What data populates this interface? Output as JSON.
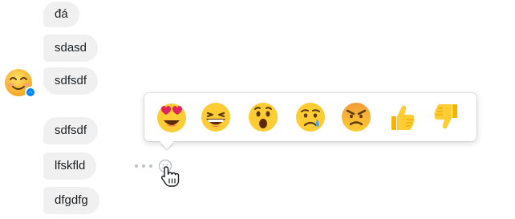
{
  "messages": [
    {
      "text": "đá"
    },
    {
      "text": "sdasd"
    },
    {
      "text": "sdfsdf"
    },
    {
      "text": "sdfsdf"
    },
    {
      "text": "lfskfld"
    },
    {
      "text": "dfgdfg"
    }
  ],
  "reactions": [
    {
      "name": "love",
      "icon": "heart-eyes-emoji-icon"
    },
    {
      "name": "haha",
      "icon": "laughing-emoji-icon"
    },
    {
      "name": "wow",
      "icon": "surprised-emoji-icon"
    },
    {
      "name": "sad",
      "icon": "crying-emoji-icon"
    },
    {
      "name": "angry",
      "icon": "angry-emoji-icon"
    },
    {
      "name": "like",
      "icon": "thumbs-up-icon"
    },
    {
      "name": "dislike",
      "icon": "thumbs-down-icon"
    }
  ],
  "colors": {
    "bubble_bg": "#f1f0f0",
    "text": "#1c1e21",
    "emoji_yellow": "#ffcc33",
    "messenger_blue": "#0084ff"
  },
  "icons": {
    "avatar": "smiling-emoji-avatar",
    "badge": "messenger-badge-icon",
    "more": "more-options-icon",
    "react": "add-reaction-icon",
    "cursor": "hand-pointer-cursor-icon"
  }
}
